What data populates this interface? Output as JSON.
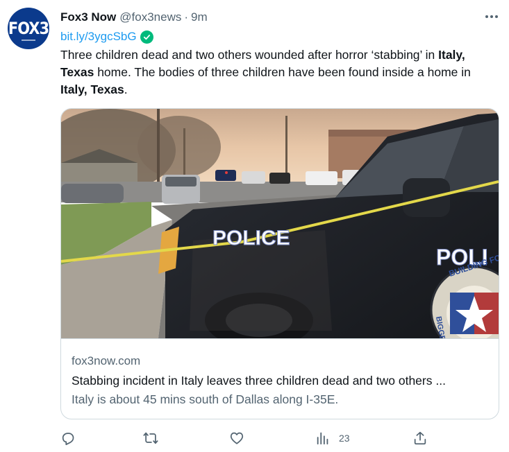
{
  "tweet": {
    "display_name": "Fox3 Now",
    "handle": "@fox3news",
    "separator": "·",
    "time": "9m",
    "avatar_text": "FOX3",
    "link_text": "bit.ly/3ygcSbG",
    "body": {
      "part1": "Three children dead and two others wounded after horror ‘stabbing’ in ",
      "bold1": "Italy, Texas",
      "part2": " home. The bodies of three children have been found inside a home in ",
      "bold2": "Italy, Texas",
      "part3": "."
    }
  },
  "card": {
    "image_alt": "Police vehicle at crime scene with yellow tape",
    "image_text_1": "POLICE",
    "image_text_2": "POLI",
    "image_text_3": "BUILDING FOR T",
    "image_text_4": "BIGGES",
    "domain": "fox3now.com",
    "title": "Stabbing incident in Italy leaves three children dead and two others ...",
    "description": "Italy is about 45 mins south of Dallas along I-35E."
  },
  "actions": {
    "reply_icon": "reply-icon",
    "retweet_icon": "retweet-icon",
    "like_icon": "heart-icon",
    "views_icon": "views-chart-icon",
    "views_count": "23",
    "share_icon": "share-icon"
  },
  "colors": {
    "accent": "#1d9bf0",
    "verified": "#00ba7c",
    "muted": "#536471",
    "border": "#cfd9de",
    "text": "#0f1419"
  }
}
